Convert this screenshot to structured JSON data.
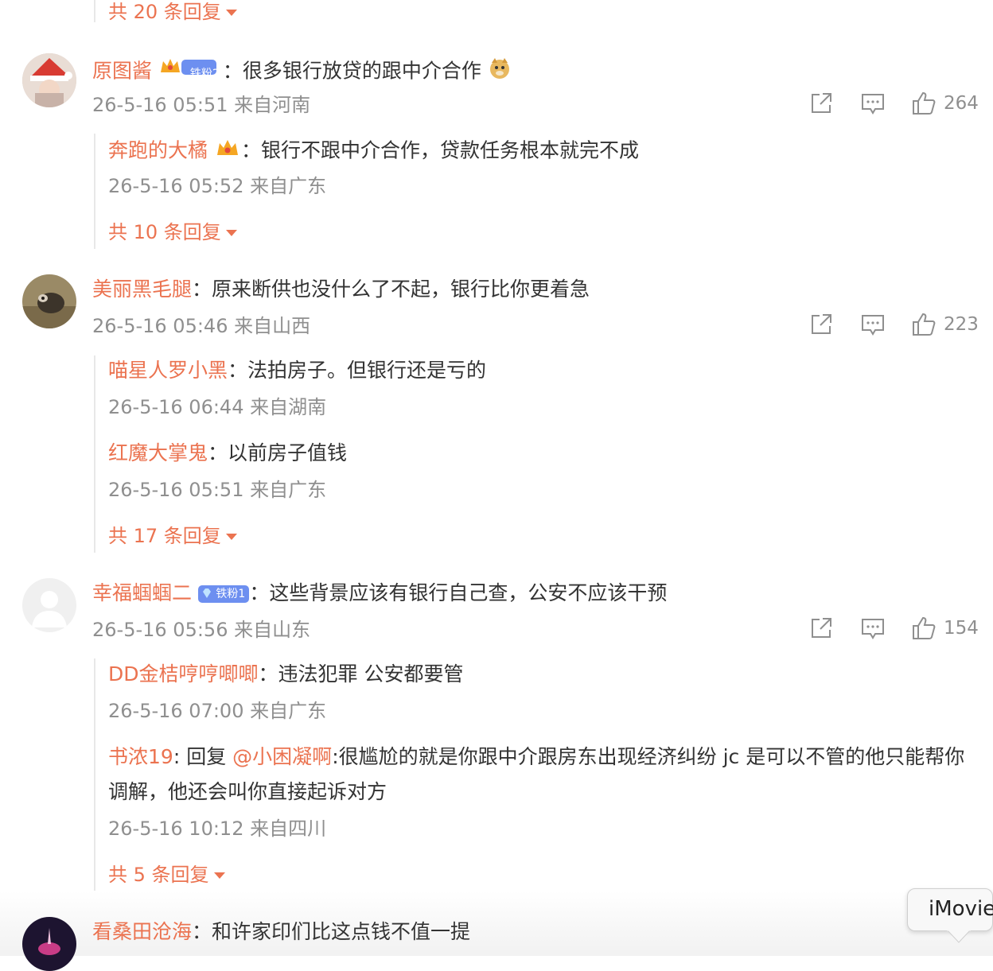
{
  "top_more": {
    "label": "共 20 条回复"
  },
  "comments": [
    {
      "user": "原图酱",
      "badge": "铁粉2",
      "text": "很多银行放贷的跟中介合作",
      "meta": "26-5-16 05:51 来自河南",
      "likes": "264",
      "replies": [
        {
          "user": "奔跑的大橘",
          "text": "银行不跟中介合作，贷款任务根本就完不成",
          "meta": "26-5-16 05:52 来自广东"
        }
      ],
      "more": "共 10 条回复"
    },
    {
      "user": "美丽黑毛腿",
      "text": "原来断供也没什么了不起，银行比你更着急",
      "meta": "26-5-16 05:46 来自山西",
      "likes": "223",
      "replies": [
        {
          "user": "喵星人罗小黑",
          "text": "法拍房子。但银行还是亏的",
          "meta": "26-5-16 06:44 来自湖南"
        },
        {
          "user": "红魔大掌鬼",
          "text": "以前房子值钱",
          "meta": "26-5-16 05:51 来自广东"
        }
      ],
      "more": "共 17 条回复"
    },
    {
      "user": "幸福蝈蝈二",
      "badge": "铁粉1",
      "text": "这些背景应该有银行自己查，公安不应该干预",
      "meta": "26-5-16 05:56 来自山东",
      "likes": "154",
      "replies": [
        {
          "user": "DD金桔哼哼唧唧",
          "text": "违法犯罪 公安都要管",
          "meta": "26-5-16 07:00 来自广东"
        },
        {
          "user": "书浓19",
          "reply_prefix": "回复",
          "mention": "@小困凝啊",
          "text": "很尴尬的就是你跟中介跟房东出现经济纠纷 jc 是可以不管的他只能帮你调解，他还会叫你直接起诉对方",
          "meta": "26-5-16 10:12 来自四川"
        }
      ],
      "more": "共 5 条回复"
    },
    {
      "user": "看桑田沧海",
      "text": "和许家印们比这点钱不值一提"
    }
  ],
  "separator": "：",
  "separator_short": ":",
  "tooltip": {
    "label": "iMovie"
  },
  "colors": {
    "username": "#eb7350",
    "meta": "#8f8f8f",
    "text": "#333333"
  },
  "icons": [
    "share-icon",
    "comment-icon",
    "thumbs-up-icon",
    "chevron-down-icon",
    "crown-icon",
    "diamond-icon",
    "doge-emoji-icon"
  ]
}
